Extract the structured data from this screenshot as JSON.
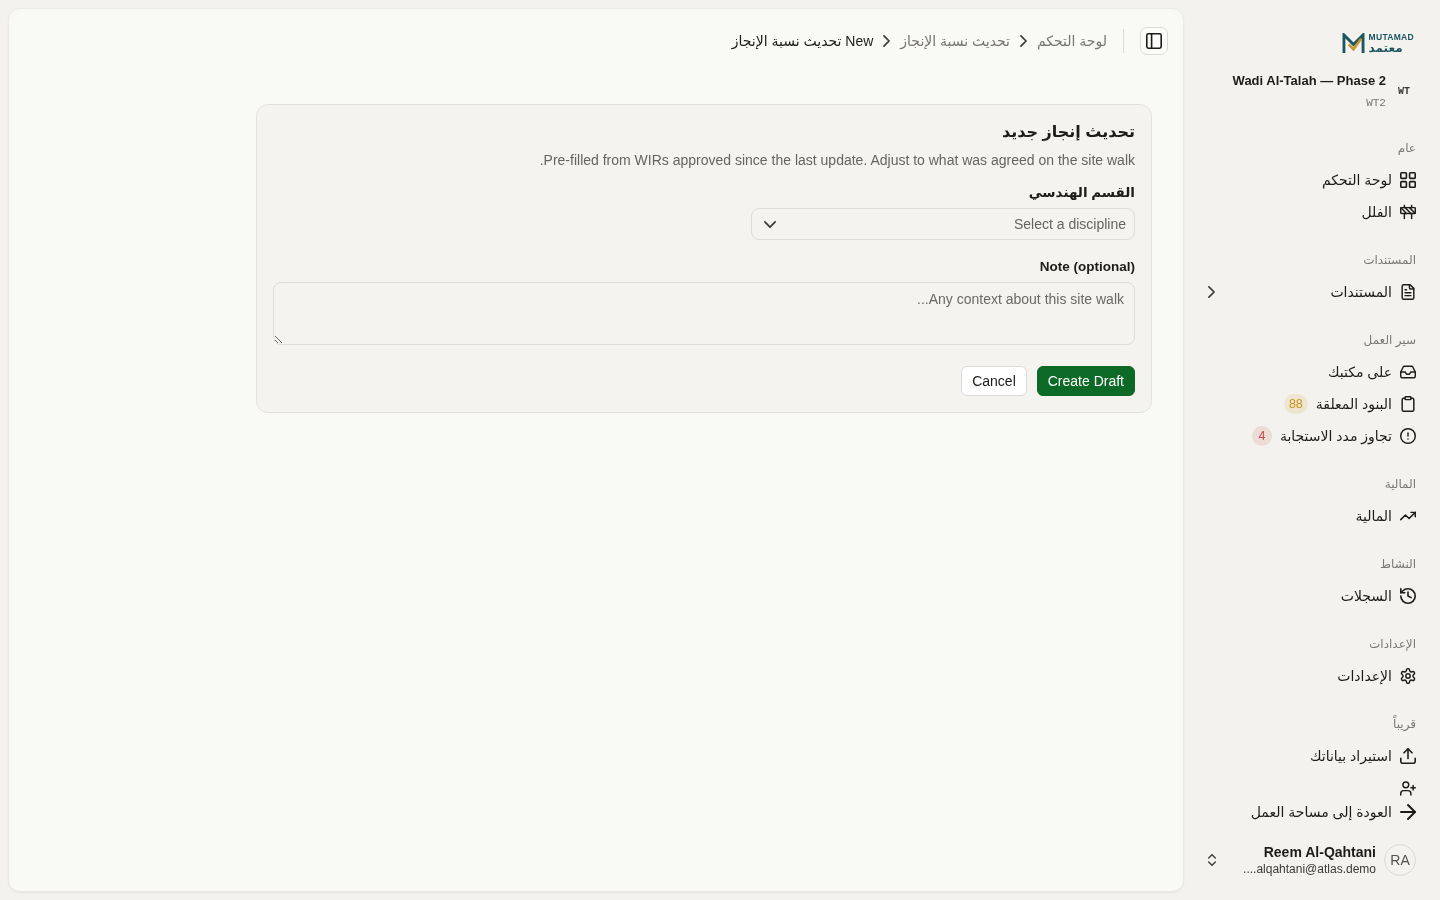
{
  "sidebar": {
    "logo": {
      "latin": "MUTAMAD",
      "arabic": "معتمد"
    },
    "project": {
      "initials": "WT",
      "name": "Wadi Al-Talah — Phase 2",
      "code": "WT2"
    },
    "sections": [
      {
        "title": "عام",
        "items": [
          {
            "kind": "link",
            "label": "لوحة التحكم",
            "selected": false
          },
          {
            "kind": "link",
            "label": "الفلل",
            "selected": false
          }
        ]
      },
      {
        "title": "المستندات",
        "items": [
          {
            "kind": "group",
            "label": "المستندات",
            "selected": false,
            "expanded": false
          }
        ]
      },
      {
        "title": "سير العمل",
        "items": [
          {
            "kind": "link",
            "label": "على مكتبك",
            "selected": false
          },
          {
            "kind": "link",
            "label": "البنود المعلقة",
            "selected": false,
            "badge": "88",
            "color": "#c8931a"
          },
          {
            "kind": "link",
            "label": "تجاوز مدد الاستجابة",
            "selected": false,
            "badge": "4",
            "color": "#c0504d"
          }
        ]
      },
      {
        "title": "المالية",
        "items": [
          {
            "kind": "link",
            "label": "المالية",
            "selected": false
          }
        ]
      },
      {
        "title": "النشاط",
        "items": [
          {
            "kind": "link",
            "label": "السجلات",
            "selected": false
          }
        ]
      },
      {
        "title": "الإعدادات",
        "items": [
          {
            "kind": "link",
            "label": "الإعدادات",
            "selected": false
          }
        ]
      },
      {
        "title": "قريباً",
        "items": [
          {
            "kind": "link",
            "label": "استيراد بياناتك",
            "selected": false
          },
          {
            "kind": "clipped",
            "selected": false
          }
        ]
      }
    ],
    "back_link": "العودة إلى مساحة العمل",
    "user": {
      "initials": "RA",
      "name": "Reem Al-Qahtani",
      "email": "....alqahtani@atlas.demo"
    }
  },
  "header": {
    "breadcrumbs": [
      {
        "label": "لوحة التحكم",
        "current": false
      },
      {
        "label": "تحديث نسبة الإنجاز",
        "current": false
      },
      {
        "label": "New تحديث نسبة الإنجاز",
        "current": true
      }
    ]
  },
  "form": {
    "title": "تحديث إنجاز جديد",
    "description": "Pre-filled from WIRs approved since the last update. Adjust to what was agreed on the site walk.",
    "fields": [
      {
        "kind": "select",
        "label": "القسم الهندسي",
        "placeholder": "Select a discipline"
      },
      {
        "kind": "textarea",
        "label": "Note (optional)",
        "placeholder": "Any context about this site walk..."
      }
    ],
    "buttons": [
      {
        "kind": "primary",
        "label": "Create Draft"
      },
      {
        "kind": "secondary",
        "label": "Cancel"
      }
    ]
  }
}
